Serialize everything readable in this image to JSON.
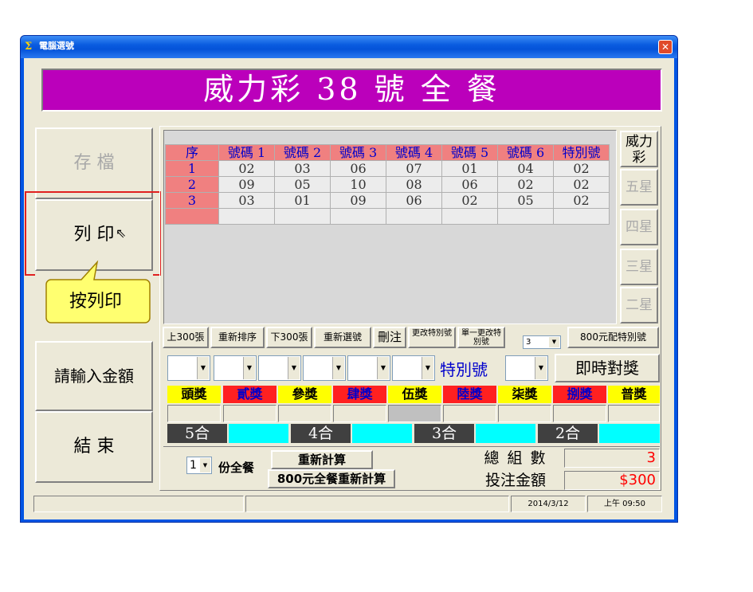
{
  "window": {
    "title": "電腦選號",
    "close_label": "✕",
    "app_icon": "Σ"
  },
  "banner": {
    "text": "威力彩 38 號 全 餐"
  },
  "side_buttons": [
    {
      "label": "存 檔"
    },
    {
      "label": "列 印"
    },
    {
      "label": "請輸入金額"
    },
    {
      "label": "結 束"
    }
  ],
  "callout": {
    "text": "按列印"
  },
  "grid": {
    "headers": [
      "序",
      "號碼 1",
      "號碼 2",
      "號碼 3",
      "號碼 4",
      "號碼 5",
      "號碼 6",
      "特別號"
    ],
    "rows": [
      [
        "1",
        "02",
        "03",
        "06",
        "07",
        "01",
        "04",
        "02"
      ],
      [
        "2",
        "09",
        "05",
        "10",
        "08",
        "06",
        "02",
        "02"
      ],
      [
        "3",
        "03",
        "01",
        "09",
        "06",
        "02",
        "05",
        "02"
      ]
    ]
  },
  "tabs": [
    "威力彩",
    "五星",
    "四星",
    "三星",
    "二星"
  ],
  "toolbar": {
    "prev": "上300張",
    "resort": "重新排序",
    "next": "下300張",
    "reselect": "重新選號",
    "delete": "刪注",
    "change_special": "更改特別號",
    "single_change": "單一更改特別號",
    "combo_value": "3",
    "special800": "800元配特別號"
  },
  "special_label": "特別號",
  "instant_btn": "即時對獎",
  "prizes": [
    "頭獎",
    "貳獎",
    "參獎",
    "肆獎",
    "伍獎",
    "陸獎",
    "柒獎",
    "捌獎",
    "普獎"
  ],
  "hits": [
    "5合",
    "4合",
    "3合",
    "2合"
  ],
  "bottom": {
    "qty": "1",
    "qty_label": "份全餐",
    "recalc": "重新計算",
    "recalc800": "800元全餐重新計算",
    "total_label": "總 組 數",
    "total_value": "3",
    "amount_label": "投注金額",
    "amount_value": "$300"
  },
  "statusbar": {
    "date": "2014/3/12",
    "time": "上午 09:50"
  },
  "colors": {
    "banner": "#bb00bb",
    "header": "#f08080",
    "prize_yellow": "#ffff00",
    "prize_red": "#ff2020",
    "hit_cyan": "#00ffff"
  }
}
